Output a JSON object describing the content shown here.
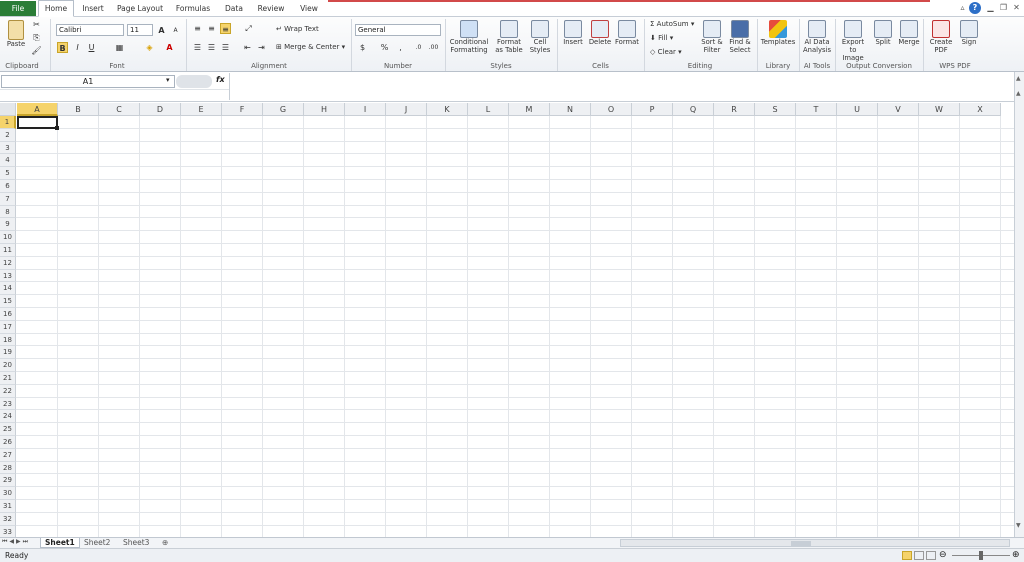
{
  "tabs": {
    "file": "File",
    "home": "Home",
    "insert": "Insert",
    "page_layout": "Page Layout",
    "formulas": "Formulas",
    "data": "Data",
    "review": "Review",
    "view": "View"
  },
  "clipboard": {
    "paste": "Paste",
    "label": "Clipboard"
  },
  "font": {
    "name": "Calibri",
    "size": "11",
    "bold": "B",
    "italic": "I",
    "underline": "U",
    "label": "Font"
  },
  "alignment": {
    "wrap": "Wrap Text",
    "merge": "Merge & Center",
    "label": "Alignment"
  },
  "number": {
    "format": "General",
    "percent": "%",
    "comma": ",",
    "label": "Number"
  },
  "styles": {
    "conditional": "Conditional",
    "conditional2": "Formatting",
    "format_table": "Format",
    "format_table2": "as Table",
    "cell_styles": "Cell",
    "cell_styles2": "Styles",
    "label": "Styles"
  },
  "cells": {
    "insert": "Insert",
    "delete": "Delete",
    "format": "Format",
    "label": "Cells"
  },
  "editing": {
    "autosum": "AutoSum",
    "fill": "Fill",
    "clear": "Clear",
    "sort": "Sort &",
    "sort2": "Filter",
    "find": "Find &",
    "find2": "Select",
    "label": "Editing"
  },
  "library": {
    "templates": "Templates",
    "label": "Library"
  },
  "ai_tools": {
    "ai": "AI Data",
    "ai2": "Analysis",
    "label": "AI Tools"
  },
  "output": {
    "export": "Export",
    "export2": "to Image",
    "split": "Split",
    "merge": "Merge",
    "label": "Output Conversion"
  },
  "wps_pdf": {
    "create": "Create",
    "create2": "PDF",
    "sign": "Sign",
    "label": "WPS PDF"
  },
  "formula_bar": {
    "name_box": "A1",
    "fx": "fx"
  },
  "columns": [
    "A",
    "B",
    "C",
    "D",
    "E",
    "F",
    "G",
    "H",
    "I",
    "J",
    "K",
    "L",
    "M",
    "N",
    "O",
    "P",
    "Q",
    "R",
    "S",
    "T",
    "U",
    "V",
    "W",
    "X"
  ],
  "rows": [
    "1",
    "2",
    "3",
    "4",
    "5",
    "6",
    "7",
    "8",
    "9",
    "10",
    "11",
    "12",
    "13",
    "14",
    "15",
    "16",
    "17",
    "18",
    "19",
    "20",
    "21",
    "22",
    "23",
    "24",
    "25",
    "26",
    "27",
    "28",
    "29",
    "30",
    "31",
    "32",
    "33"
  ],
  "sheets": [
    "Sheet1",
    "Sheet2",
    "Sheet3"
  ],
  "status": {
    "ready": "Ready"
  },
  "colors": {
    "file_tab": "#2a7d37",
    "selected_header": "#f5d36b",
    "accent_red": "#d24a4a"
  }
}
